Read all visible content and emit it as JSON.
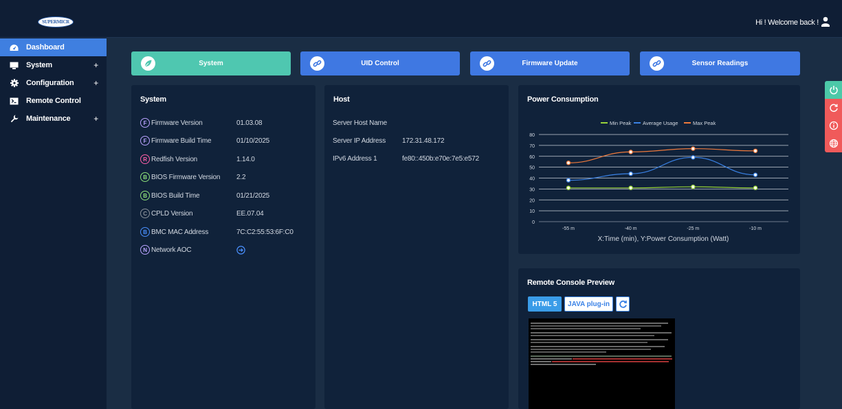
{
  "header": {
    "logo_text": "SUPERMICR",
    "welcome_text": "Hi ! Welcome back !",
    "user_icon": "user-icon"
  },
  "sidebar": {
    "items": [
      {
        "label": "Dashboard",
        "icon": "dashboard-icon",
        "active": true,
        "expandable": false
      },
      {
        "label": "System",
        "icon": "monitor-icon",
        "active": false,
        "expandable": true,
        "plus": "+"
      },
      {
        "label": "Configuration",
        "icon": "gear-icon",
        "active": false,
        "expandable": true,
        "plus": "+"
      },
      {
        "label": "Remote Control",
        "icon": "terminal-icon",
        "active": false,
        "expandable": false
      },
      {
        "label": "Maintenance",
        "icon": "wrench-icon",
        "active": false,
        "expandable": true,
        "plus": "+"
      }
    ]
  },
  "tabs": [
    {
      "label": "System",
      "icon": "leaf-icon",
      "active": true
    },
    {
      "label": "UID Control",
      "icon": "link-icon",
      "active": false
    },
    {
      "label": "Firmware Update",
      "icon": "link-icon",
      "active": false
    },
    {
      "label": "Sensor Readings",
      "icon": "link-icon",
      "active": false
    }
  ],
  "system_panel": {
    "title": "System",
    "rows": [
      {
        "badge": "F",
        "badge_color": "#b9a2ff",
        "label": "Firmware Version",
        "value": "01.03.08"
      },
      {
        "badge": "F",
        "badge_color": "#b9a2ff",
        "label": "Firmware Build Time",
        "value": "01/10/2025"
      },
      {
        "badge": "R",
        "badge_color": "#ff5fa8",
        "label": "Redfish Version",
        "value": "1.14.0"
      },
      {
        "badge": "B",
        "badge_color": "#8de07a",
        "label": "BIOS Firmware Version",
        "value": "2.2"
      },
      {
        "badge": "B",
        "badge_color": "#8de07a",
        "label": "BIOS Build Time",
        "value": "01/21/2025"
      },
      {
        "badge": "C",
        "badge_color": "#8a9099",
        "label": "CPLD Version",
        "value": "EE.07.04"
      },
      {
        "badge": "B",
        "badge_color": "#4a90ff",
        "label": "BMC MAC Address",
        "value": "7C:C2:55:53:6F:C0"
      },
      {
        "badge": "N",
        "badge_color": "#b9a2ff",
        "label": "Network AOC",
        "value": ""
      }
    ],
    "network_aoc_icon": "arrow-right-circle-icon"
  },
  "host_panel": {
    "title": "Host",
    "rows": [
      {
        "label": "Server Host Name",
        "value": ""
      },
      {
        "label": "Server IP Address",
        "value": "172.31.48.172"
      },
      {
        "label": "IPv6 Address 1",
        "value": "fe80::450b:e70e:7e5:e572"
      }
    ]
  },
  "power_panel": {
    "title": "Power Consumption"
  },
  "chart_data": {
    "type": "line",
    "title": "",
    "xlabel": "X:Time (min), Y:Power Consumption (Watt)",
    "ylabel": "",
    "categories": [
      "-55 m",
      "-40 m",
      "-25 m",
      "-10 m"
    ],
    "ylim": [
      0,
      80
    ],
    "yticks": [
      0,
      10,
      20,
      30,
      40,
      50,
      60,
      70,
      80
    ],
    "grid": true,
    "legend_position": "top-center",
    "series": [
      {
        "name": "Min Peak",
        "color": "#9ad43a",
        "values": [
          31,
          31,
          32,
          31
        ]
      },
      {
        "name": "Average Usage",
        "color": "#3a82e6",
        "values": [
          38,
          44,
          59,
          43
        ]
      },
      {
        "name": "Max Peak",
        "color": "#f07a3c",
        "values": [
          54,
          64,
          67,
          65
        ]
      }
    ]
  },
  "console_panel": {
    "title": "Remote Console Preview",
    "html5_label": "HTML 5",
    "java_label": "JAVA plug-in",
    "refresh_icon": "refresh-icon"
  },
  "float_actions": [
    {
      "icon": "power-icon",
      "color": "#4cc9a8"
    },
    {
      "icon": "reset-icon",
      "color": "#f05a5a"
    },
    {
      "icon": "info-icon",
      "color": "#f05a5a"
    },
    {
      "icon": "globe-icon",
      "color": "#f05a5a"
    }
  ]
}
